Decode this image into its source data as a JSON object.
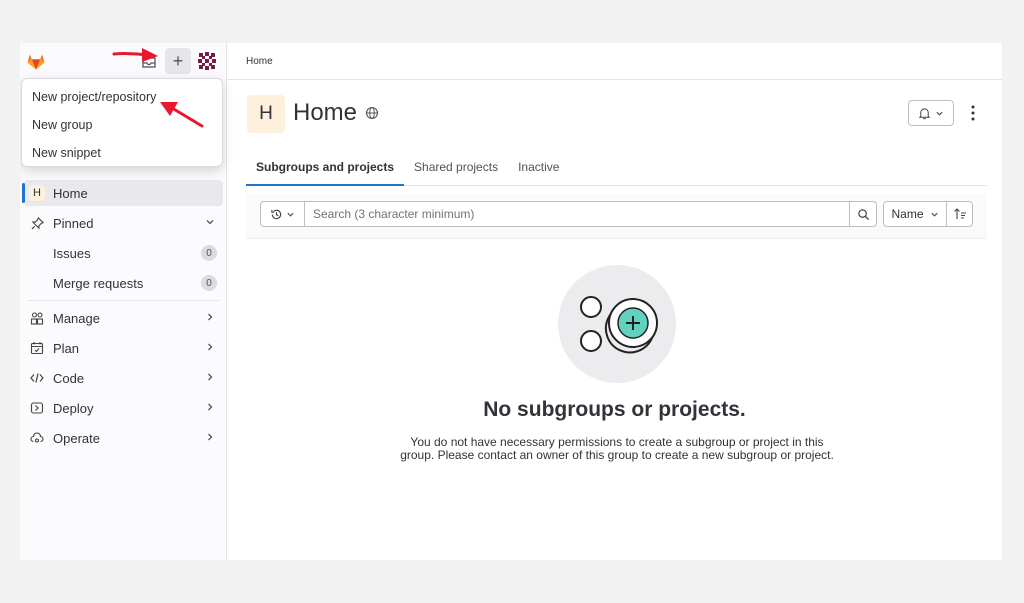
{
  "sidebar": {
    "new_menu": {
      "items": [
        {
          "label": "New project/repository"
        },
        {
          "label": "New group"
        },
        {
          "label": "New snippet"
        }
      ]
    },
    "nav": {
      "home": {
        "avatar_letter": "H",
        "label": "Home"
      },
      "pinned": {
        "label": "Pinned"
      },
      "issues": {
        "label": "Issues",
        "count": "0"
      },
      "merge_requests": {
        "label": "Merge requests",
        "count": "0"
      },
      "manage": {
        "label": "Manage"
      },
      "plan": {
        "label": "Plan"
      },
      "code": {
        "label": "Code"
      },
      "deploy": {
        "label": "Deploy"
      },
      "operate": {
        "label": "Operate"
      }
    }
  },
  "breadcrumb": {
    "label": "Home"
  },
  "page": {
    "avatar_letter": "H",
    "title": "Home"
  },
  "tabs": [
    {
      "label": "Subgroups and projects",
      "active": true
    },
    {
      "label": "Shared projects"
    },
    {
      "label": "Inactive"
    }
  ],
  "filter": {
    "search_placeholder": "Search (3 character minimum)",
    "sort_label": "Name"
  },
  "empty_state": {
    "title": "No subgroups or projects.",
    "description": "You do not have necessary permissions to create a subgroup or project in this group. Please contact an owner of this group to create a new subgroup or project."
  },
  "colors": {
    "accent": "#1f75cb",
    "annotation_arrow": "#e8192c",
    "empty_illustration_bg": "#ececef",
    "empty_illustration_accent": "#63d1c0"
  }
}
